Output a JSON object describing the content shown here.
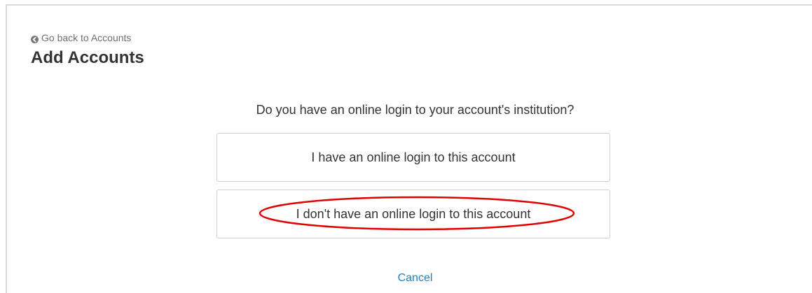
{
  "header": {
    "back_link_label": "Go back to Accounts",
    "back_icon": "circle-arrow-left-icon",
    "title": "Add Accounts"
  },
  "main": {
    "question": "Do you have an online login to your account's institution?",
    "options": [
      {
        "label": "I have an online login to this account"
      },
      {
        "label": "I don't have an online login to this account",
        "highlighted": true
      }
    ],
    "cancel_label": "Cancel"
  },
  "colors": {
    "link": "#1f7ec4",
    "highlight": "#e00000",
    "border": "#cfcfcf",
    "muted_text": "#6f6f6f",
    "text": "#333333"
  }
}
